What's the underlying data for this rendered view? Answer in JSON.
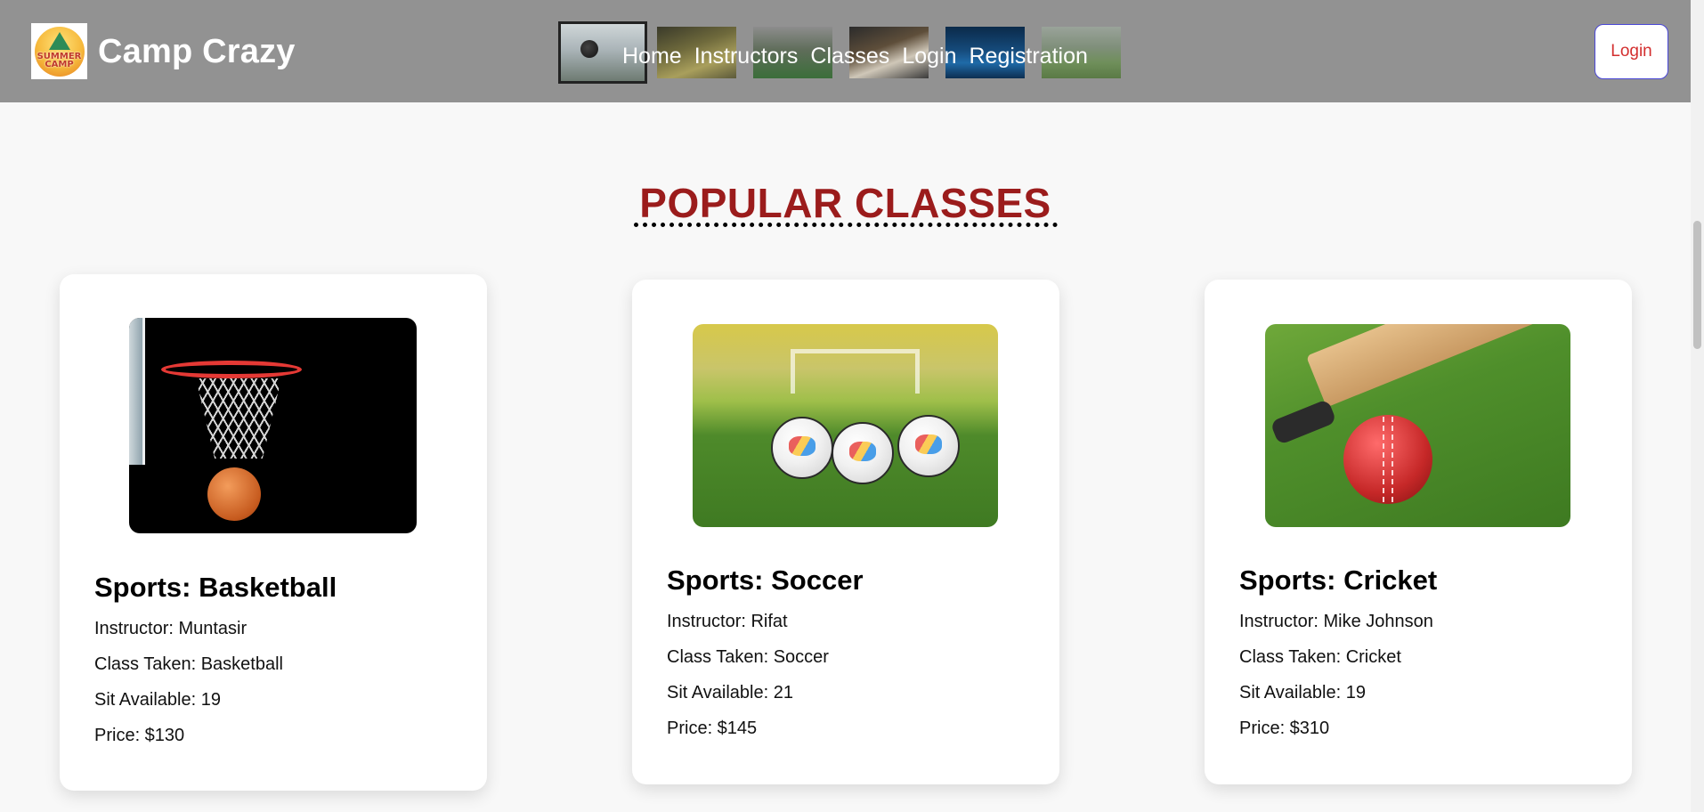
{
  "header": {
    "brand": "Camp Crazy",
    "logo_text": "SUMMER CAMP",
    "nav": [
      "Home",
      "Instructors",
      "Classes",
      "Login",
      "Registration"
    ],
    "login_label": "Login",
    "thumbnail_count": 6
  },
  "section": {
    "title": "POPULAR CLASSES"
  },
  "cards": [
    {
      "heading": "Sports: Basketball",
      "instructor": "Instructor: Muntasir",
      "class_taken": "Class Taken: Basketball",
      "sit_available": "Sit Available: 19",
      "price": "Price: $130"
    },
    {
      "heading": "Sports: Soccer",
      "instructor": "Instructor: Rifat",
      "class_taken": "Class Taken: Soccer",
      "sit_available": "Sit Available: 21",
      "price": "Price: $145"
    },
    {
      "heading": "Sports: Cricket",
      "instructor": "Instructor: Mike Johnson",
      "class_taken": "Class Taken: Cricket",
      "sit_available": "Sit Available: 19",
      "price": "Price: $310"
    }
  ],
  "colors": {
    "header_bg": "#929292",
    "title": "#9b1c1c",
    "login_text": "#d32f2f",
    "login_border": "#4a47d6"
  }
}
